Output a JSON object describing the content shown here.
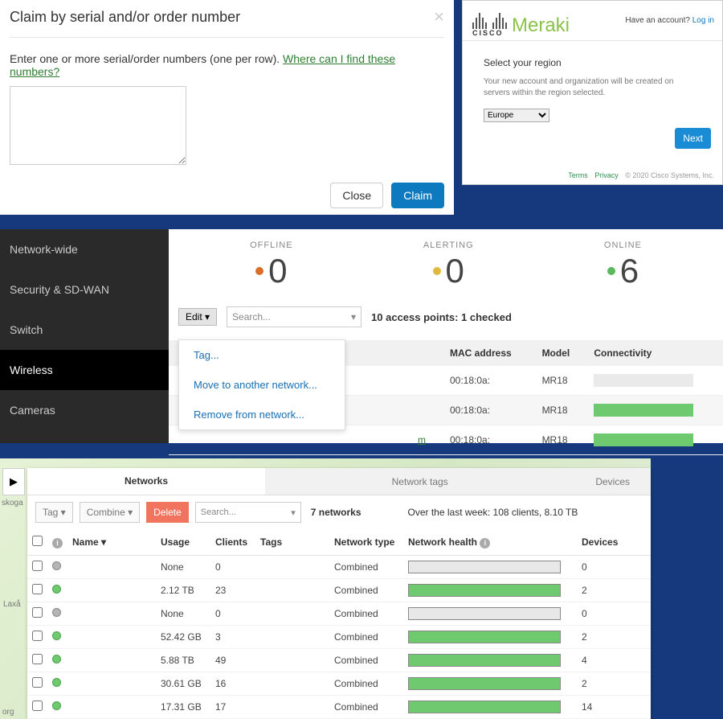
{
  "modal": {
    "title": "Claim by serial and/or order number",
    "prompt_prefix": "Enter one or more serial/order numbers (one per row). ",
    "prompt_link": "Where can I find these numbers?",
    "close_label": "Close",
    "claim_label": "Claim"
  },
  "region": {
    "brand_small": "CISCO",
    "brand_big": "Meraki",
    "login_prefix": "Have an account? ",
    "login_link": "Log in",
    "title": "Select your region",
    "desc": "Your new account and organization will be created on servers within the region selected.",
    "selected": "Europe",
    "next_label": "Next",
    "terms": "Terms",
    "privacy": "Privacy",
    "copyright": "© 2020 Cisco Systems, Inc."
  },
  "dashboard": {
    "sidebar": [
      "Network-wide",
      "Security & SD-WAN",
      "Switch",
      "Wireless",
      "Cameras"
    ],
    "sidebar_active": 3,
    "status": {
      "offline": {
        "label": "OFFLINE",
        "value": "0",
        "color": "orange"
      },
      "alerting": {
        "label": "ALERTING",
        "value": "0",
        "color": "yellow"
      },
      "online": {
        "label": "ONLINE",
        "value": "6",
        "color": "green"
      }
    },
    "edit_label": "Edit ▾",
    "search_placeholder": "Search...",
    "ap_summary": "10 access points: 1 checked",
    "dropdown": [
      "Tag...",
      "Move to another network...",
      "Remove from network..."
    ],
    "table_headers": {
      "mac": "MAC address",
      "model": "Model",
      "conn": "Connectivity"
    },
    "rows": [
      {
        "mac": "00:18:0a:",
        "model": "MR18",
        "conn": "off"
      },
      {
        "mac": "00:18:0a:",
        "model": "MR18",
        "conn": "online"
      },
      {
        "mac": "00:18:0a:",
        "model": "MR18",
        "conn": "online"
      }
    ],
    "link_frag": "m"
  },
  "networks": {
    "tabs": {
      "networks": "Networks",
      "tags": "Network tags",
      "devices": "Devices"
    },
    "toolbar": {
      "tag": "Tag ▾",
      "combine": "Combine ▾",
      "delete": "Delete",
      "search": "Search..."
    },
    "count_label": "7 networks",
    "stats": "Over the last week: 108 clients, 8.10 TB",
    "headers": {
      "name": "Name ▾",
      "usage": "Usage",
      "clients": "Clients",
      "tags": "Tags",
      "type": "Network type",
      "health": "Network health",
      "devices": "Devices"
    },
    "rows": [
      {
        "status": "gray",
        "usage": "None",
        "clients": "0",
        "type": "Combined",
        "health": "gray",
        "devices": "0"
      },
      {
        "status": "green",
        "usage": "2.12 TB",
        "clients": "23",
        "type": "Combined",
        "health": "green",
        "devices": "2"
      },
      {
        "status": "gray",
        "usage": "None",
        "clients": "0",
        "type": "Combined",
        "health": "gray",
        "devices": "0"
      },
      {
        "status": "green",
        "usage": "52.42 GB",
        "clients": "3",
        "type": "Combined",
        "health": "green",
        "devices": "2"
      },
      {
        "status": "green",
        "usage": "5.88 TB",
        "clients": "49",
        "type": "Combined",
        "health": "green",
        "devices": "4"
      },
      {
        "status": "green",
        "usage": "30.61 GB",
        "clients": "16",
        "type": "Combined",
        "health": "green",
        "devices": "2"
      },
      {
        "status": "green",
        "usage": "17.31 GB",
        "clients": "17",
        "type": "Combined",
        "health": "green",
        "devices": "14"
      }
    ],
    "map_labels": [
      "skoga",
      "Laxå",
      "org"
    ]
  }
}
